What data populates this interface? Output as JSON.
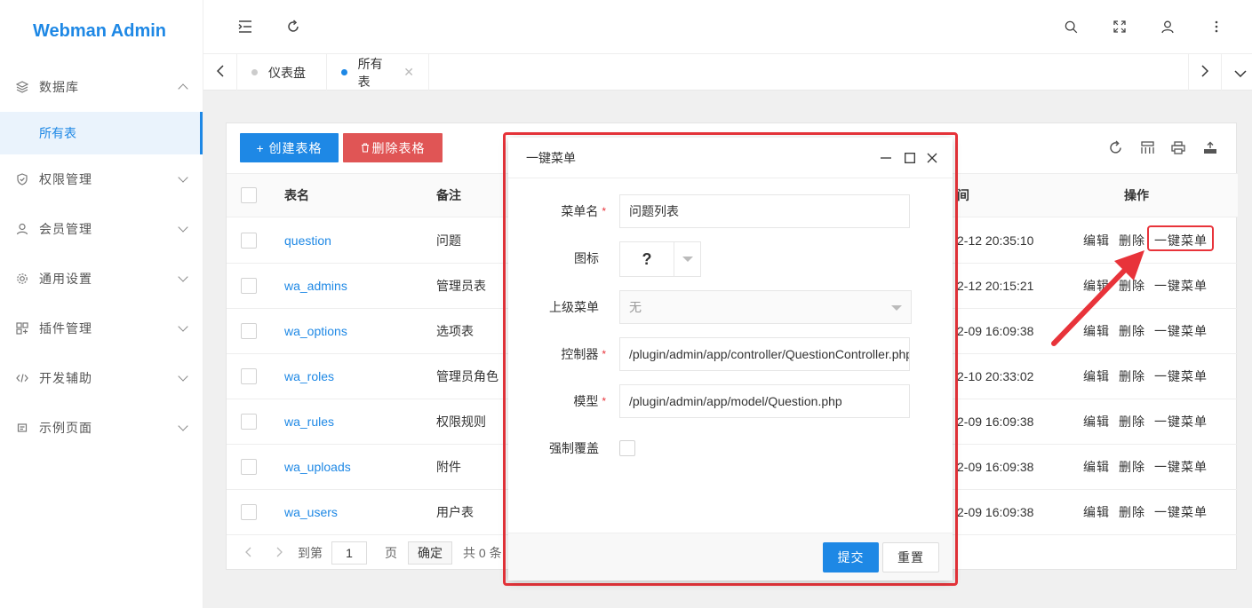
{
  "app": {
    "title": "Webman Admin"
  },
  "sidebar": {
    "items": [
      {
        "label": "数据库",
        "icon": "layers-icon",
        "expanded": true
      },
      {
        "label": "权限管理",
        "icon": "shield-icon"
      },
      {
        "label": "会员管理",
        "icon": "user-icon"
      },
      {
        "label": "通用设置",
        "icon": "gear-icon"
      },
      {
        "label": "插件管理",
        "icon": "plugin-icon"
      },
      {
        "label": "开发辅助",
        "icon": "code-icon"
      },
      {
        "label": "示例页面",
        "icon": "page-icon"
      }
    ],
    "sub_item": "所有表"
  },
  "header": {
    "icons": [
      "menu-fold-icon",
      "refresh-icon",
      "search-icon",
      "fullscreen-icon",
      "user-icon",
      "more-icon"
    ]
  },
  "tabs": [
    {
      "label": "仪表盘",
      "active": false
    },
    {
      "label": "所有表",
      "active": true
    }
  ],
  "toolbar": {
    "create_label": "+ 创建表格",
    "delete_label": "删除表格"
  },
  "table": {
    "columns": [
      "表名",
      "备注",
      "间",
      "操作"
    ],
    "rows": [
      {
        "name": "question",
        "remark": "问题",
        "time": "2-12 20:35:10"
      },
      {
        "name": "wa_admins",
        "remark": "管理员表",
        "time": "2-12 20:15:21"
      },
      {
        "name": "wa_options",
        "remark": "选项表",
        "time": "2-09 16:09:38"
      },
      {
        "name": "wa_roles",
        "remark": "管理员角色",
        "time": "2-10 20:33:02"
      },
      {
        "name": "wa_rules",
        "remark": "权限规则",
        "time": "2-09 16:09:38"
      },
      {
        "name": "wa_uploads",
        "remark": "附件",
        "time": "2-09 16:09:38"
      },
      {
        "name": "wa_users",
        "remark": "用户表",
        "time": "2-09 16:09:38"
      }
    ],
    "actions": {
      "edit": "编辑",
      "delete": "删除",
      "menu": "一键菜单"
    }
  },
  "pager": {
    "goto": "到第",
    "page_value": "1",
    "page_unit": "页",
    "confirm": "确定",
    "total": "共 0 条"
  },
  "modal": {
    "title": "一键菜单",
    "fields": {
      "menu_name_label": "菜单名",
      "menu_name_value": "问题列表",
      "icon_label": "图标",
      "icon_value": "?",
      "parent_label": "上级菜单",
      "parent_value": "无",
      "controller_label": "控制器",
      "controller_value": "/plugin/admin/app/controller/QuestionController.php",
      "model_label": "模型",
      "model_value": "/plugin/admin/app/model/Question.php",
      "overwrite_label": "强制覆盖"
    },
    "submit": "提交",
    "reset": "重置",
    "required_mark": "*"
  },
  "colors": {
    "accent": "#1e88e5",
    "danger": "#e05555",
    "annotation": "#e8333a"
  }
}
